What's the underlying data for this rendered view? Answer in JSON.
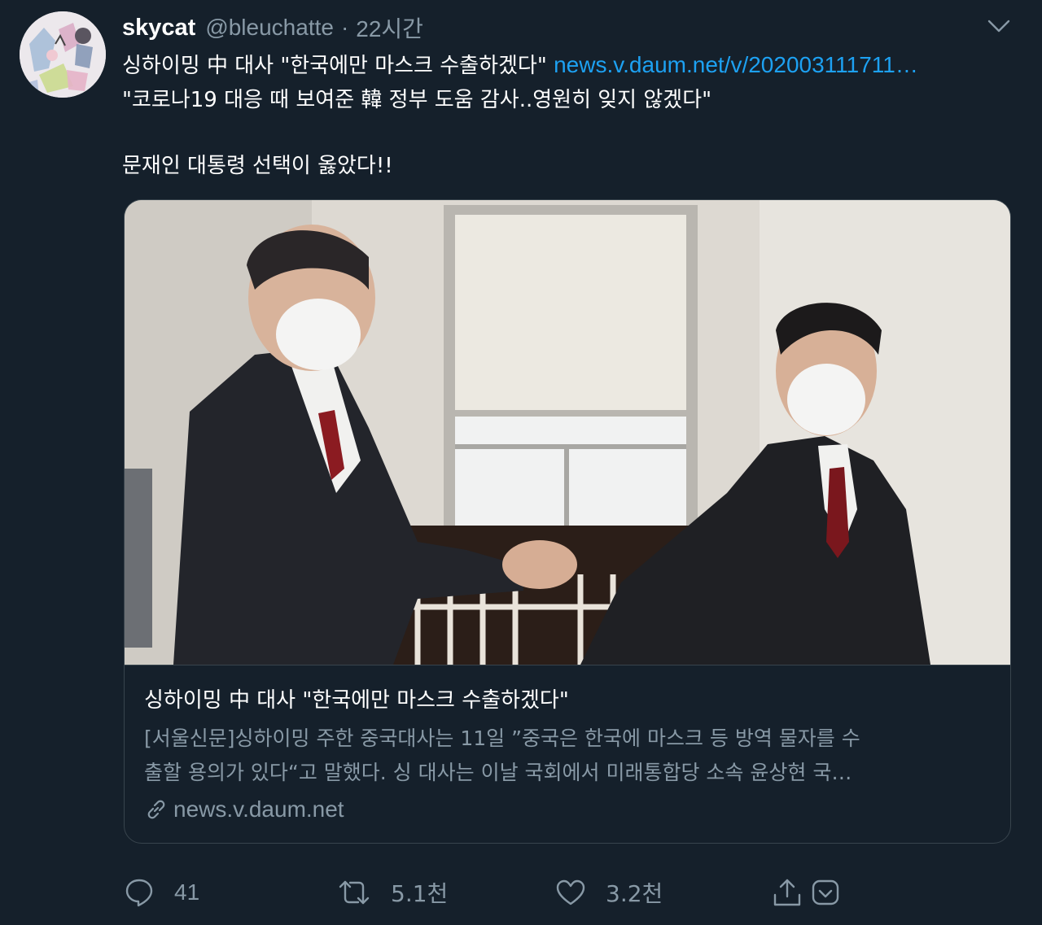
{
  "tweet": {
    "author_name": "skycat",
    "author_handle": "@bleuchatte",
    "separator": "·",
    "time": "22시간",
    "line1_text": "싱하이밍 中 대사 \"한국에만 마스크 수출하겠다\"",
    "line1_link": "news.v.daum.net/v/202003111711…",
    "line2_text": "\"코로나19 대응 때 보여준 韓 정부 도움 감사..영원히 잊지 않겠다\"",
    "line3_text": "문재인 대통령 선택이 옳았다!!"
  },
  "card": {
    "title": "싱하이밍 中 대사 \"한국에만 마스크 수출하겠다\"",
    "description_line1": "[서울신문]싱하이밍 주한 중국대사는 11일 ”중국은 한국에 마스크 등 방역 물자를 수",
    "description_line2": "출할 용의가 있다“고 말했다. 싱 대사는 이날 국회에서 미래통합당 소속 윤상현 국…",
    "domain": "news.v.daum.net"
  },
  "actions": {
    "reply_count": "41",
    "retweet_count": "5.1천",
    "like_count": "3.2천"
  },
  "icons": {
    "avatar": "avatar-illustration",
    "caret": "chevron-down-icon",
    "reply": "reply-icon",
    "retweet": "retweet-icon",
    "like": "heart-icon",
    "share": "share-icon",
    "save": "bookmark-icon",
    "link": "link-icon"
  },
  "colors": {
    "background": "#15202b",
    "secondary_text": "#8899a6",
    "link": "#1da1f2",
    "border": "#38444d"
  }
}
